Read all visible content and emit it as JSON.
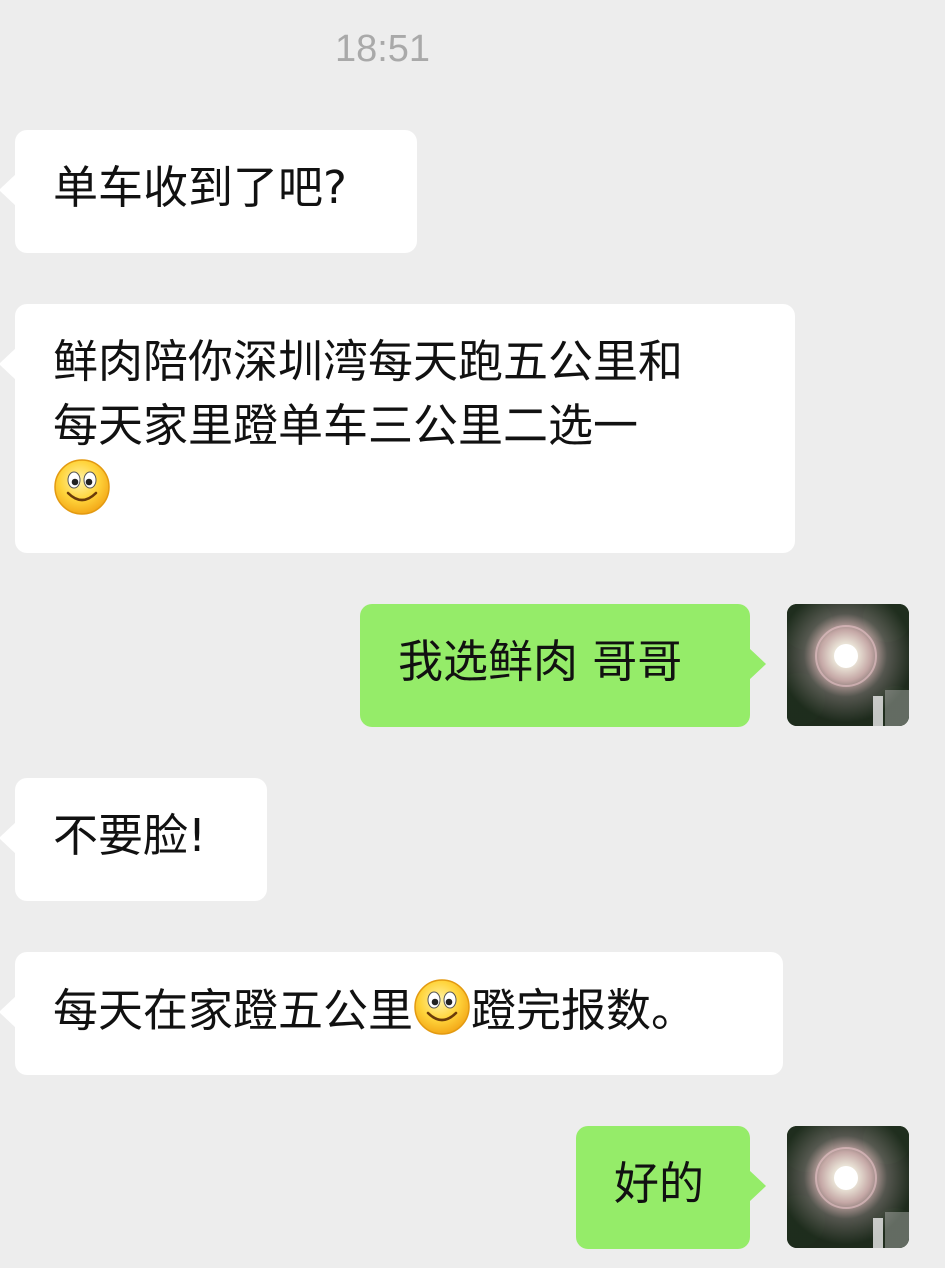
{
  "chat": {
    "timestamp": "18:51",
    "messages": [
      {
        "side": "in",
        "text": "单车收到了吧?"
      },
      {
        "side": "in",
        "line1": "鲜肉陪你深圳湾每天跑五公里和",
        "line2": "每天家里蹬单车三公里二选一",
        "emoji": "smile-emoji"
      },
      {
        "side": "out",
        "text": "我选鲜肉 哥哥"
      },
      {
        "side": "in",
        "text": "不要脸!"
      },
      {
        "side": "in",
        "before": "每天在家蹬五公里",
        "emoji": "smile-emoji",
        "after": "蹬完报数。"
      },
      {
        "side": "out",
        "text": "好的"
      }
    ]
  },
  "colors": {
    "background": "#ededed",
    "incoming_bubble": "#ffffff",
    "outgoing_bubble": "#95ec69",
    "timestamp": "#a9a9a9"
  }
}
